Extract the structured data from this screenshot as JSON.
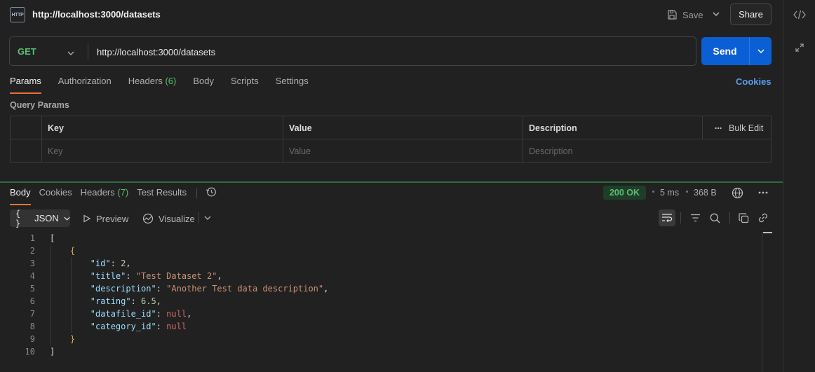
{
  "tab": {
    "title": "http://localhost:3000/datasets",
    "icon_text": "HTTP"
  },
  "toolbar": {
    "save_label": "Save",
    "share_label": "Share"
  },
  "request": {
    "method": "GET",
    "url": "http://localhost:3000/datasets",
    "send_label": "Send",
    "tabs": [
      {
        "label": "Params",
        "count": ""
      },
      {
        "label": "Authorization",
        "count": ""
      },
      {
        "label": "Headers",
        "count": "(6)"
      },
      {
        "label": "Body",
        "count": ""
      },
      {
        "label": "Scripts",
        "count": ""
      },
      {
        "label": "Settings",
        "count": ""
      }
    ],
    "cookies_label": "Cookies",
    "query_params_title": "Query Params",
    "table": {
      "headers": {
        "key": "Key",
        "value": "Value",
        "description": "Description",
        "bulk_edit": "Bulk Edit"
      },
      "placeholders": {
        "key": "Key",
        "value": "Value",
        "description": "Description"
      }
    }
  },
  "response": {
    "tabs": [
      {
        "label": "Body",
        "count": ""
      },
      {
        "label": "Cookies",
        "count": ""
      },
      {
        "label": "Headers",
        "count": "(7)"
      },
      {
        "label": "Test Results",
        "count": ""
      }
    ],
    "status": "200 OK",
    "time": "5 ms",
    "size": "368 B",
    "format": "JSON",
    "format_prefix": "{ }",
    "preview_label": "Preview",
    "visualize_label": "Visualize",
    "lines": [
      {
        "n": "1",
        "tokens": [
          {
            "t": "[",
            "c": "punc"
          }
        ]
      },
      {
        "n": "2",
        "tokens": [
          {
            "t": "    ",
            "c": "punc"
          },
          {
            "t": "{",
            "c": "brace"
          }
        ]
      },
      {
        "n": "3",
        "tokens": [
          {
            "t": "        ",
            "c": "punc"
          },
          {
            "t": "\"id\"",
            "c": "key"
          },
          {
            "t": ": ",
            "c": "punc"
          },
          {
            "t": "2",
            "c": "num"
          },
          {
            "t": ",",
            "c": "punc"
          }
        ]
      },
      {
        "n": "4",
        "tokens": [
          {
            "t": "        ",
            "c": "punc"
          },
          {
            "t": "\"title\"",
            "c": "key"
          },
          {
            "t": ": ",
            "c": "punc"
          },
          {
            "t": "\"Test Dataset 2\"",
            "c": "str"
          },
          {
            "t": ",",
            "c": "punc"
          }
        ]
      },
      {
        "n": "5",
        "tokens": [
          {
            "t": "        ",
            "c": "punc"
          },
          {
            "t": "\"description\"",
            "c": "key"
          },
          {
            "t": ": ",
            "c": "punc"
          },
          {
            "t": "\"Another Test data description\"",
            "c": "str"
          },
          {
            "t": ",",
            "c": "punc"
          }
        ]
      },
      {
        "n": "6",
        "tokens": [
          {
            "t": "        ",
            "c": "punc"
          },
          {
            "t": "\"rating\"",
            "c": "key"
          },
          {
            "t": ": ",
            "c": "punc"
          },
          {
            "t": "6.5",
            "c": "num"
          },
          {
            "t": ",",
            "c": "punc"
          }
        ]
      },
      {
        "n": "7",
        "tokens": [
          {
            "t": "        ",
            "c": "punc"
          },
          {
            "t": "\"datafile_id\"",
            "c": "key"
          },
          {
            "t": ": ",
            "c": "punc"
          },
          {
            "t": "null",
            "c": "null"
          },
          {
            "t": ",",
            "c": "punc"
          }
        ]
      },
      {
        "n": "8",
        "tokens": [
          {
            "t": "        ",
            "c": "punc"
          },
          {
            "t": "\"category_id\"",
            "c": "key"
          },
          {
            "t": ": ",
            "c": "punc"
          },
          {
            "t": "null",
            "c": "null"
          }
        ]
      },
      {
        "n": "9",
        "tokens": [
          {
            "t": "    ",
            "c": "punc"
          },
          {
            "t": "}",
            "c": "brace"
          }
        ]
      },
      {
        "n": "10",
        "tokens": [
          {
            "t": "]",
            "c": "punc"
          }
        ]
      }
    ]
  },
  "colors": {
    "accent_tab": "#e8703a",
    "send": "#0b5fd4",
    "status_ok": "#5bbd72",
    "link": "#5b9bf0"
  }
}
